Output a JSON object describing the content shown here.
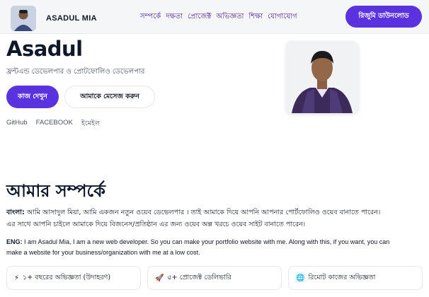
{
  "brand": {
    "name": "ASADUL MIA"
  },
  "nav": {
    "items": [
      "সম্পর্কে",
      "দক্ষতা",
      "প্রোজেক্ট",
      "অভিজ্ঞতা",
      "শিক্ষা",
      "যোগাযোগ"
    ]
  },
  "resume_button": "রিজুমি ডাউনলোড",
  "hero": {
    "name": "Asadul",
    "subtitle": "ফ্রন্টএন্ড ডেভেলপার ও প্রোটফোলিও ডেভেলপার",
    "primary_button": "কাজ দেখুন",
    "secondary_button": "আমাকে মেসেজ করুন",
    "socials": [
      "GitHub",
      "FACEBOOK",
      "ইমেইল"
    ]
  },
  "about": {
    "title": "আমার সম্পর্কে",
    "bn_label": "বাংলা:",
    "bn_text": "আমি আসাদুল মিয়া, আমি একজন নতুন ওয়েব ডেভেলপার । তাই আমাকে দিয়ে আপনি আপনার পোর্টফোলিও ওয়েব বানাতে পারেন। এর সাথে আপনি চাইলে আমাকে দিয়ে বিজনেস/প্রতিষ্ঠান এর জন্য ওয়েব অল্প খরচে ওয়েব সাইট বানাতে পারেন।",
    "en_label": "ENG:",
    "en_text": "I am Asadul Mia, I am a new web developer. So you can make your portfolio website with me. Along with this, if you want, you can make a website for your business/organization with me at a low cost."
  },
  "cards": [
    {
      "icon": "⚡",
      "icon_name": "lightning-icon",
      "label": "১+ বছরের অভিজ্ঞতা (উদাহরণ)"
    },
    {
      "icon": "🚀",
      "icon_name": "rocket-icon",
      "label": "৫+ প্রোজেক্ট ডেলিভারি"
    },
    {
      "icon": "🌐",
      "icon_name": "globe-icon",
      "label": "রিমোট কাজের অভিজ্ঞতা"
    }
  ],
  "colors": {
    "accent": "#5b32e0",
    "nav_text": "#4c1d95"
  }
}
